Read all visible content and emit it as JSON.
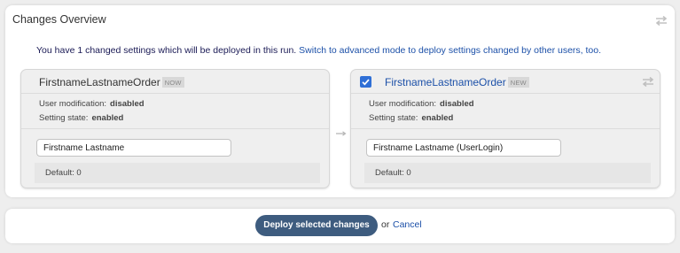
{
  "overview": {
    "title": "Changes Overview",
    "info_text": "You have 1 changed settings which will be deployed in this run.",
    "info_link": "Switch to advanced mode to deploy settings changed by other users, too."
  },
  "cards": {
    "old": {
      "name": "FirstnameLastnameOrder",
      "tag": "NOW",
      "user_modification_label": "User modification:",
      "user_modification_value": "disabled",
      "setting_state_label": "Setting state:",
      "setting_state_value": "enabled",
      "value": "Firstname Lastname",
      "default": "Default: 0"
    },
    "new": {
      "name": "FirstnameLastnameOrder",
      "tag": "NEW",
      "checked": true,
      "user_modification_label": "User modification:",
      "user_modification_value": "disabled",
      "setting_state_label": "Setting state:",
      "setting_state_value": "enabled",
      "value": "Firstname Lastname (UserLogin)",
      "default": "Default: 0"
    }
  },
  "footer": {
    "deploy_label": "Deploy selected changes",
    "or_text": "or",
    "cancel_label": "Cancel"
  },
  "colors": {
    "link": "#1c50a8",
    "button": "#3e5c7f",
    "checkbox": "#2f6fd6"
  }
}
